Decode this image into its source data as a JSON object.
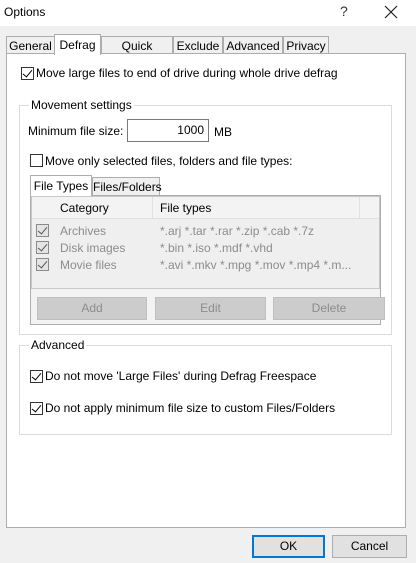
{
  "window": {
    "title": "Options",
    "help_label": "?"
  },
  "tabs": [
    {
      "label": "General"
    },
    {
      "label": "Defrag"
    },
    {
      "label": "Quick Defrag"
    },
    {
      "label": "Exclude"
    },
    {
      "label": "Advanced"
    },
    {
      "label": "Privacy"
    }
  ],
  "defrag": {
    "move_large_files_label": "Move large files to end of drive during whole drive defrag",
    "movement_settings": {
      "title": "Movement settings",
      "min_size_label": "Minimum file size:",
      "min_size_value": "1000",
      "min_size_unit": "MB",
      "move_selected_label": "Move only selected files, folders and file types:",
      "subtabs": [
        {
          "label": "File Types"
        },
        {
          "label": "Files/Folders"
        }
      ],
      "columns": {
        "category": "Category",
        "file_types": "File types"
      },
      "rows": [
        {
          "category": "Archives",
          "types": "*.arj *.tar *.rar *.zip *.cab *.7z"
        },
        {
          "category": "Disk images",
          "types": "*.bin *.iso *.mdf *.vhd"
        },
        {
          "category": "Movie files",
          "types": "*.avi *.mkv *.mpg *.mov *.mp4 *.m..."
        }
      ],
      "buttons": {
        "add": "Add",
        "edit": "Edit",
        "delete": "Delete"
      }
    },
    "advanced": {
      "title": "Advanced",
      "no_move_large_label": "Do not move 'Large Files' during Defrag Freespace",
      "no_min_size_label": "Do not apply minimum file size to custom Files/Folders"
    }
  },
  "footer": {
    "ok": "OK",
    "cancel": "Cancel"
  }
}
